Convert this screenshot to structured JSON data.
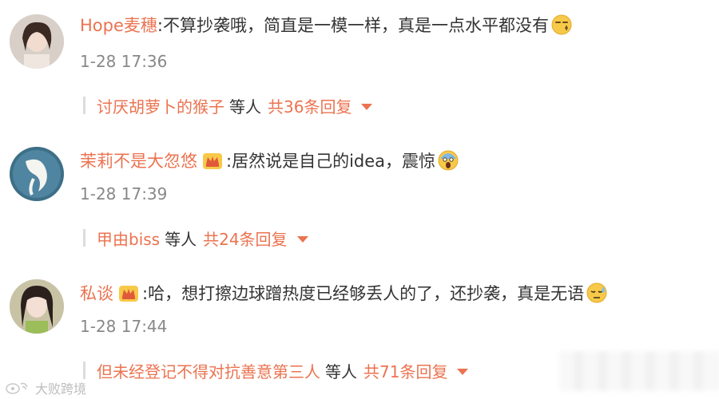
{
  "comments": [
    {
      "username": "Hope麦穗",
      "text": ":不算抄袭哦，简直是一模一样，真是一点水平都没有",
      "emoji": "smirk-face-emoji",
      "vip": false,
      "time": "1-28 17:36",
      "reply_user": "讨厌胡萝卜的猴子",
      "reply_mid": "等人",
      "reply_count": "共36条回复"
    },
    {
      "username": "茉莉不是大忽悠",
      "text": ":居然说是自己的idea，震惊",
      "emoji": "scream-face-emoji",
      "vip": true,
      "time": "1-28 17:39",
      "reply_user": "甲由biss",
      "reply_mid": "等人",
      "reply_count": "共24条回复"
    },
    {
      "username": "私谈",
      "text": ":哈，想打擦边球蹭热度已经够丢人的了，还抄袭，真是无语",
      "emoji": "sweat-face-emoji",
      "vip": true,
      "time": "1-28 17:44",
      "reply_user": "但未经登记不得对抗善意第三人",
      "reply_mid": "等人",
      "reply_count": "共71条回复"
    }
  ],
  "watermark": {
    "text": "大败跨境"
  },
  "colors": {
    "accent": "#eb7350",
    "text": "#333333",
    "muted": "#888888"
  }
}
